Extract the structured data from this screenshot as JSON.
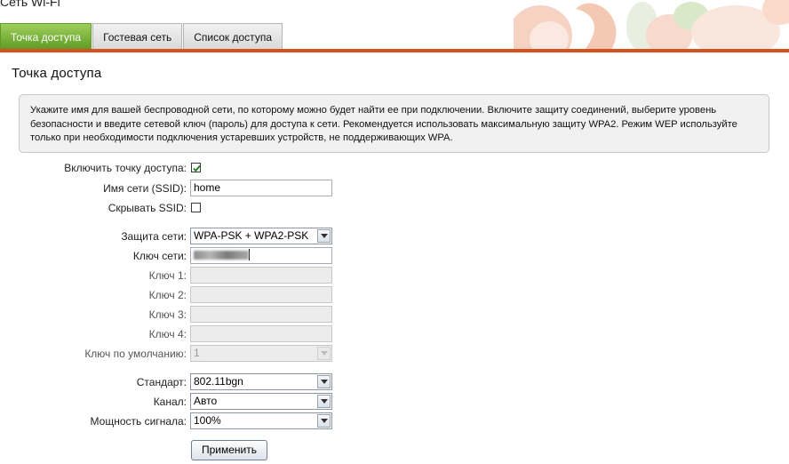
{
  "app_title": "Сеть Wi-Fi",
  "tabs": [
    {
      "label": "Точка доступа",
      "active": true
    },
    {
      "label": "Гостевая сеть",
      "active": false
    },
    {
      "label": "Список доступа",
      "active": false
    }
  ],
  "page_title": "Точка доступа",
  "info_text": "Укажите имя для вашей беспроводной сети, по которому можно будет найти ее при подключении. Включите защиту соединений, выберите уровень безопасности и введите сетевой ключ (пароль) для доступа к сети. Рекомендуется использовать максимальную защиту WPA2. Режим WEP используйте только при необходимости подключения устаревших устройств, не поддерживающих WPA.",
  "form": {
    "enable_ap": {
      "label": "Включить точку доступа:",
      "checked": true
    },
    "ssid": {
      "label": "Имя сети (SSID):",
      "value": "home"
    },
    "hide_ssid": {
      "label": "Скрывать SSID:",
      "checked": false
    },
    "security": {
      "label": "Защита сети:",
      "value": "WPA-PSK + WPA2-PSK"
    },
    "network_key": {
      "label": "Ключ сети:"
    },
    "key1": {
      "label": "Ключ 1:",
      "value": ""
    },
    "key2": {
      "label": "Ключ 2:",
      "value": ""
    },
    "key3": {
      "label": "Ключ 3:",
      "value": ""
    },
    "key4": {
      "label": "Ключ 4:",
      "value": ""
    },
    "default_key": {
      "label": "Ключ по умолчанию:",
      "value": "1"
    },
    "standard": {
      "label": "Стандарт:",
      "value": "802.11bgn"
    },
    "channel": {
      "label": "Канал:",
      "value": "Авто"
    },
    "power": {
      "label": "Мощность сигнала:",
      "value": "100%"
    }
  },
  "apply_label": "Применить",
  "colors": {
    "accent_orange": "#d5531e",
    "active_tab": "#6fa830"
  }
}
